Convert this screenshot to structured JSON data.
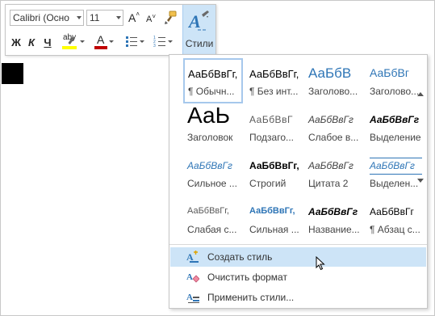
{
  "toolbar": {
    "font_name": "Calibri (Осно",
    "font_size": "11",
    "grow_font": "A",
    "shrink_font": "A",
    "bold": "Ж",
    "italic": "К",
    "underline": "Ч",
    "highlight": "аbу",
    "font_color": "А",
    "styles_label": "Стили",
    "highlight_color": "#ffff00",
    "font_color_bar": "#c00000",
    "accent": "#2e75b6"
  },
  "gallery": {
    "styles": [
      {
        "sample": "АаБбВвГг,",
        "name": "¶ Обычн..."
      },
      {
        "sample": "АаБбВвГг,",
        "name": "¶ Без инт..."
      },
      {
        "sample": "АаБбВ",
        "name": "Заголово..."
      },
      {
        "sample": "АаБбВг",
        "name": "Заголово..."
      },
      {
        "sample": "АаЬ",
        "name": "Заголовок"
      },
      {
        "sample": "АаБбВвГ",
        "name": "Подзаго..."
      },
      {
        "sample": "АаБбВвГг",
        "name": "Слабое в..."
      },
      {
        "sample": "АаБбВвГг",
        "name": "Выделение"
      },
      {
        "sample": "АаБбВвГг",
        "name": "Сильное ..."
      },
      {
        "sample": "АаБбВвГг,",
        "name": "Строгий"
      },
      {
        "sample": "АаБбВвГг",
        "name": "Цитата 2"
      },
      {
        "sample": "АаБбВвГг",
        "name": "Выделен..."
      },
      {
        "sample": "АаБбВвГг,",
        "name": "Слабая с..."
      },
      {
        "sample": "АаБбВвГг,",
        "name": "Сильная ..."
      },
      {
        "sample": "АаБбВвГг",
        "name": "Название..."
      },
      {
        "sample": "АаБбВвГг",
        "name": "¶ Абзац с..."
      }
    ],
    "commands": [
      {
        "label": "Создать стиль"
      },
      {
        "label": "Очистить формат"
      },
      {
        "label": "Применить стили..."
      }
    ]
  }
}
